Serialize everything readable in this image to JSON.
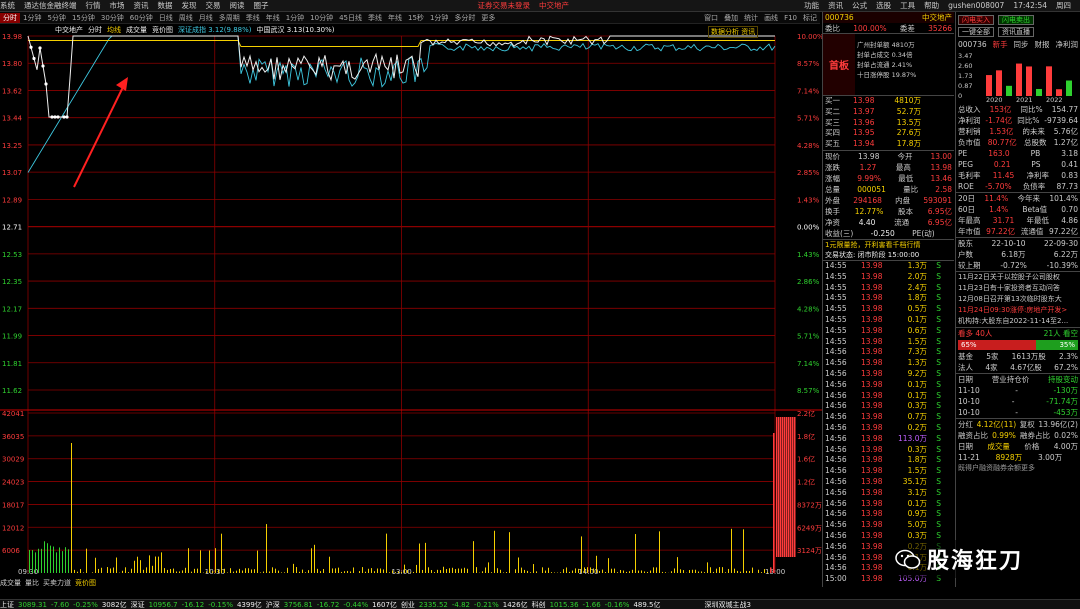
{
  "menubar": {
    "items": [
      "系统",
      "通达信金融终端",
      "行情",
      "市场",
      "资讯",
      "数据",
      "发现",
      "交易",
      "阅读",
      "圈子"
    ],
    "center_alert": "证券交易未登录",
    "center_stock": "中交地产",
    "right_items": [
      "功能",
      "资讯",
      "公式",
      "选股",
      "工具",
      "帮助",
      "gushen008007",
      "17:42:54",
      "周四"
    ]
  },
  "periodbar": {
    "items": [
      "分时",
      "1分钟",
      "5分钟",
      "15分钟",
      "30分钟",
      "60分钟",
      "日线",
      "周线",
      "月线",
      "多周期",
      "季线",
      "年线",
      "1分钟",
      "10分钟",
      "45日线",
      "季线",
      "年线",
      "15秒",
      "1分钟",
      "多分时",
      "更多"
    ],
    "active_index": 0,
    "right_items": [
      "窗口",
      "叠加",
      "统计",
      "画线",
      "F10",
      "标记"
    ]
  },
  "legend": {
    "name": "中交地产",
    "mode": "分时",
    "avg_label": "均线",
    "vol_label": "成交量",
    "compare_label": "竞价图",
    "index_tag": "深证成指 3.12(9.88%)",
    "other_tag": "中国武汉 3.13(10.30%)",
    "right_tag": "数据分析 资讯"
  },
  "chart": {
    "price_ticks": [
      "13.98",
      "13.80",
      "13.62",
      "13.44",
      "13.25",
      "13.07",
      "12.89",
      "12.71",
      "12.53",
      "12.35",
      "12.17",
      "11.99",
      "11.81",
      "11.62"
    ],
    "pct_ticks": [
      "10.00%",
      "8.57%",
      "7.14%",
      "5.71%",
      "4.28%",
      "2.85%",
      "1.43%",
      "0.00%",
      "1.43%",
      "2.86%",
      "4.28%",
      "5.71%",
      "7.14%",
      "8.57%"
    ],
    "vol_ticks": [
      "42041",
      "36035",
      "30029",
      "24023",
      "18017",
      "12012",
      "6006"
    ],
    "vol_ticks_right": [
      "2.2亿",
      "1.8亿",
      "1.6亿",
      "1.2亿",
      "8372万",
      "6249万",
      "3124万"
    ],
    "time_ticks": [
      "09:30",
      "10:30",
      "13:00",
      "14:00",
      "15:00"
    ],
    "colors": {
      "price": "#f0f0f0",
      "avg": "#f5d000",
      "index": "#3ec8e0",
      "grid": "#8b0000",
      "up": "#ff3c3c",
      "down": "#2fd12f"
    }
  },
  "quote": {
    "code": "000736",
    "name": "中交地产",
    "webi_label": "委比",
    "webi_pct": "100.00%",
    "weicha_label": "委差",
    "weicha": "35266",
    "promo": "首板",
    "promo_lines": [
      "广州封单额 4810万",
      "封单占成交 0.34倍",
      "封单占流通 2.41%",
      "十日涨停股 19.87%"
    ],
    "sells": [
      {
        "label": "卖五",
        "price": "",
        "vol": ""
      }
    ],
    "buys": [
      {
        "label": "买一",
        "price": "13.98",
        "vol": "4810万"
      },
      {
        "label": "买二",
        "price": "13.97",
        "vol": "52.7万"
      },
      {
        "label": "买三",
        "price": "13.96",
        "vol": "13.5万"
      },
      {
        "label": "买四",
        "price": "13.95",
        "vol": "27.6万"
      },
      {
        "label": "买五",
        "price": "13.94",
        "vol": "17.8万"
      }
    ],
    "stats": [
      [
        "现价",
        "13.98",
        "今开",
        "13.00"
      ],
      [
        "涨跌",
        "1.27",
        "最高",
        "13.98"
      ],
      [
        "涨幅",
        "9.99%",
        "最低",
        "13.46"
      ],
      [
        "总量",
        "000051",
        "量比",
        "2.58"
      ],
      [
        "外盘",
        "294168",
        "内盘",
        "593091"
      ],
      [
        "换手",
        "12.77%",
        "股本",
        "6.95亿"
      ],
      [
        "净资",
        "4.40",
        "流通",
        "6.95亿"
      ],
      [
        "收益(三)",
        "-0.250",
        "PE(动)",
        ""
      ]
    ],
    "notice1": "1元限量抢，开利害看千档行情",
    "notice2": "交易状态: 闭市阶段 15:00:00"
  },
  "trades": [
    [
      "14:55",
      "13.98",
      "1.3万",
      "S"
    ],
    [
      "14:55",
      "13.98",
      "2.0万",
      "S"
    ],
    [
      "14:55",
      "13.98",
      "2.4万",
      "S"
    ],
    [
      "14:55",
      "13.98",
      "1.8万",
      "S"
    ],
    [
      "14:55",
      "13.98",
      "0.5万",
      "S"
    ],
    [
      "14:55",
      "13.98",
      "0.1万",
      "S"
    ],
    [
      "14:55",
      "13.98",
      "0.6万",
      "S"
    ],
    [
      "14:55",
      "13.98",
      "1.5万",
      "S"
    ],
    [
      "14:56",
      "13.98",
      "7.3万",
      "S"
    ],
    [
      "14:56",
      "13.98",
      "1.3万",
      "S"
    ],
    [
      "14:56",
      "13.98",
      "9.2万",
      "S"
    ],
    [
      "14:56",
      "13.98",
      "0.1万",
      "S"
    ],
    [
      "14:56",
      "13.98",
      "0.1万",
      "S"
    ],
    [
      "14:56",
      "13.98",
      "0.3万",
      "S"
    ],
    [
      "14:56",
      "13.98",
      "0.7万",
      "S"
    ],
    [
      "14:56",
      "13.98",
      "0.2万",
      "S"
    ],
    [
      "14:56",
      "13.98",
      "113.0万",
      "S"
    ],
    [
      "14:56",
      "13.98",
      "0.3万",
      "S"
    ],
    [
      "14:56",
      "13.98",
      "1.8万",
      "S"
    ],
    [
      "14:56",
      "13.98",
      "1.5万",
      "S"
    ],
    [
      "14:56",
      "13.98",
      "35.1万",
      "S"
    ],
    [
      "14:56",
      "13.98",
      "3.1万",
      "S"
    ],
    [
      "14:56",
      "13.98",
      "0.1万",
      "S"
    ],
    [
      "14:56",
      "13.98",
      "0.9万",
      "S"
    ],
    [
      "14:56",
      "13.98",
      "5.0万",
      "S"
    ],
    [
      "14:56",
      "13.98",
      "0.3万",
      "S"
    ],
    [
      "14:56",
      "13.98",
      "0.2万",
      "S"
    ],
    [
      "14:56",
      "13.98",
      "0.1万",
      "S"
    ],
    [
      "14:56",
      "13.98",
      "0.1万",
      "S"
    ],
    [
      "15:00",
      "13.98",
      "105.0万",
      "S"
    ]
  ],
  "farright": {
    "buttons": [
      "闪电买入",
      "闪电卖出",
      "一键全部",
      "资讯直播"
    ],
    "code": "000736",
    "tabs": [
      "新手",
      "同步",
      "财报",
      "净利润"
    ],
    "bar_years": [
      "2020",
      "2021",
      "2022"
    ],
    "bar_values": [
      1.73,
      2.12,
      0.84,
      2.68,
      2.44,
      0.58,
      2.45,
      0.56,
      1.28
    ],
    "bar_ylabels": [
      "3.47",
      "2.60",
      "1.73",
      "0.87",
      "0"
    ],
    "fin_rows": [
      [
        "总收入",
        "153亿",
        "同比%",
        "154.77"
      ],
      [
        "净利润",
        "-1.74亿",
        "同比%",
        "-9739.64"
      ],
      [
        "营利销",
        "1.53亿",
        "的未来",
        "5.76亿"
      ],
      [
        "负市值",
        "80.77亿",
        "总股数",
        "1.27亿"
      ],
      [
        "PE",
        "163.0",
        "PB",
        "3.18"
      ],
      [
        "PEG",
        "0.21",
        "PS",
        "0.41"
      ],
      [
        "毛利率",
        "11.45",
        "净利率",
        "0.83"
      ],
      [
        "ROE",
        "-5.70%",
        "负债率",
        "87.73"
      ]
    ],
    "perf_rows": [
      [
        "20日",
        "11.4%",
        "今年来",
        "101.4%"
      ],
      [
        "60日",
        "1.4%",
        "Beta值",
        "0.70"
      ],
      [
        "年最高",
        "31.71",
        "年最低",
        "4.86"
      ],
      [
        "年市值",
        "97.22亿",
        "流通值",
        "97.22亿"
      ]
    ],
    "holder_rows": [
      [
        "股东",
        "22-10-10",
        "22-09-30"
      ],
      [
        "户数",
        "6.18万",
        "6.22万"
      ],
      [
        "较上期",
        "-0.72%",
        "-10.39%"
      ]
    ],
    "news": [
      "11月22日关于以控股子公司股权",
      "11月23日有十家投资者互动问答",
      "12月08日召开第13次临时股东大",
      "11月24日09:30涨停:房地产开发>",
      "机构持:大股东自2022-11-14至2..."
    ],
    "sentiment_left": "65%",
    "sentiment_right": "35%",
    "sentiment_label": "看多 40人",
    "sentiment_right_label": "21人 看空",
    "inst_rows": [
      [
        "基金",
        "5家",
        "1613万股",
        "2.3%"
      ],
      [
        "法人",
        "4家",
        "4.67亿股",
        "67.2%"
      ]
    ],
    "date_rows": [
      [
        "日期",
        "营业持仓价",
        "持股变动"
      ],
      [
        "11-10",
        "-",
        "-130万"
      ],
      [
        "10-10",
        "-",
        "-71.74万"
      ],
      [
        "10-10",
        "-",
        "-453万"
      ]
    ],
    "bottom_rows": [
      [
        "分红",
        "4.12亿(11)",
        "复权",
        "13.96亿(2)"
      ],
      [
        "融资占比",
        "0.99%",
        "融券占比",
        "0.02%"
      ],
      [
        "日期",
        "成交量",
        "价格",
        "4.00万"
      ],
      [
        "11-21",
        "8928万",
        "3.00万",
        ""
      ]
    ],
    "bottom_note": "既得户融资融券余额更多"
  },
  "tabs_bottom": [
    "成交量",
    "量比",
    "买卖力道",
    "竞价图"
  ],
  "indexbar": [
    {
      "name": "上证",
      "val": "3089.31",
      "chg": "-7.60",
      "pct": "-0.25%",
      "amt": "3082亿"
    },
    {
      "name": "深证",
      "val": "10956.7",
      "chg": "-16.12",
      "pct": "-0.15%",
      "amt": "4399亿"
    },
    {
      "name": "沪深",
      "val": "3756.81",
      "chg": "-16.72",
      "pct": "-0.44%",
      "amt": "1607亿"
    },
    {
      "name": "创业",
      "val": "2335.52",
      "chg": "-4.82",
      "pct": "-0.21%",
      "amt": "1426亿"
    },
    {
      "name": "科创",
      "val": "1015.36",
      "chg": "-1.66",
      "pct": "-0.16%",
      "amt": "489.5亿"
    }
  ],
  "index_tail": "深圳双城主战3",
  "watermark": {
    "text": "股海狂刀"
  }
}
